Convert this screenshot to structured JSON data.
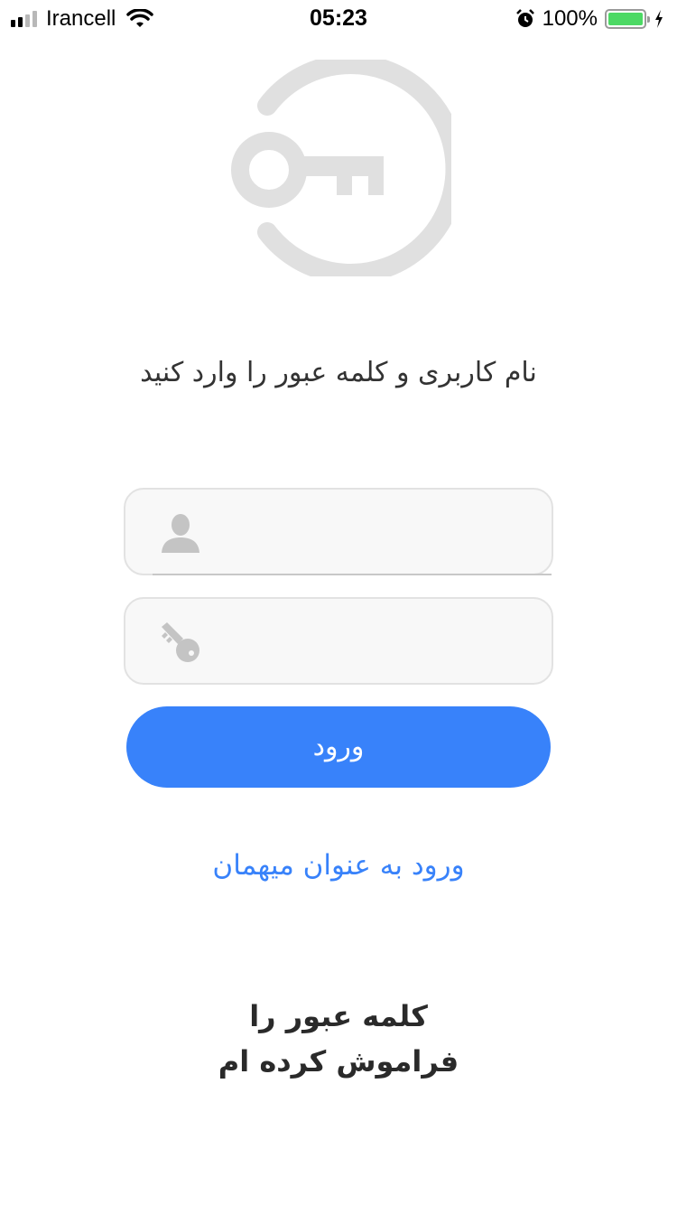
{
  "status_bar": {
    "carrier": "Irancell",
    "time": "05:23",
    "battery": "100%",
    "signal_bars_filled": 2,
    "signal_bars_total": 4,
    "icons": [
      "signal-icon",
      "wifi-icon",
      "alarm-icon",
      "battery-icon",
      "charging-icon"
    ],
    "battery_color": "#4cd964"
  },
  "logo": {
    "icon": "key-logo-icon",
    "color": "#e0e0e0"
  },
  "login": {
    "instruction": "نام کاربری و کلمه عبور را وارد کنید",
    "username": {
      "icon": "user-icon",
      "value": "",
      "placeholder": ""
    },
    "password": {
      "icon": "key-icon",
      "value": "",
      "placeholder": ""
    },
    "submit_label": "ورود",
    "guest_label": "ورود به عنوان میهمان",
    "forgot_label": "کلمه عبور را فراموش کرده ام"
  },
  "colors": {
    "accent": "#3882fa",
    "field_background": "#f8f8f8",
    "field_border": "#e2e2e2",
    "icon_gray": "#c4c4c4"
  }
}
